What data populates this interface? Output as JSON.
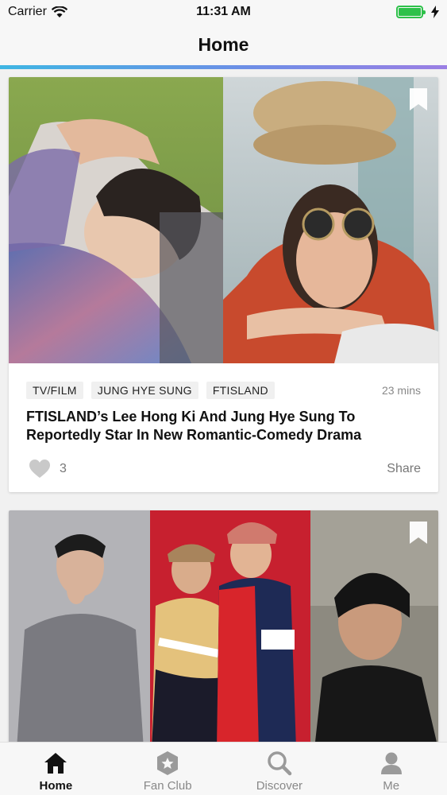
{
  "status_bar": {
    "carrier": "Carrier",
    "time": "11:31 AM",
    "battery_level": 1.0,
    "battery_color": "#2ec14a"
  },
  "nav": {
    "title": "Home"
  },
  "feed": [
    {
      "tags": [
        "TV/FILM",
        "JUNG HYE SUNG",
        "FTISLAND"
      ],
      "time_ago": "23 mins",
      "title": "FTISLAND’s Lee Hong Ki And Jung Hye Sung To Reportedly Star In New Romantic-Comedy Drama",
      "likes": "3",
      "share_label": "Share",
      "bookmark_icon": "bookmark-icon",
      "like_icon": "heart-icon"
    },
    {
      "bookmark_icon": "bookmark-icon"
    }
  ],
  "tab_bar": {
    "items": [
      {
        "label": "Home",
        "icon": "home-icon",
        "active": true
      },
      {
        "label": "Fan Club",
        "icon": "star-badge-icon",
        "active": false
      },
      {
        "label": "Discover",
        "icon": "search-icon",
        "active": false
      },
      {
        "label": "Me",
        "icon": "person-icon",
        "active": false
      }
    ]
  },
  "colors": {
    "accent_gradient_start": "#3fb6e3",
    "accent_gradient_end": "#9b7fe4",
    "active_tab": "#111111",
    "inactive_tab": "#888888"
  }
}
